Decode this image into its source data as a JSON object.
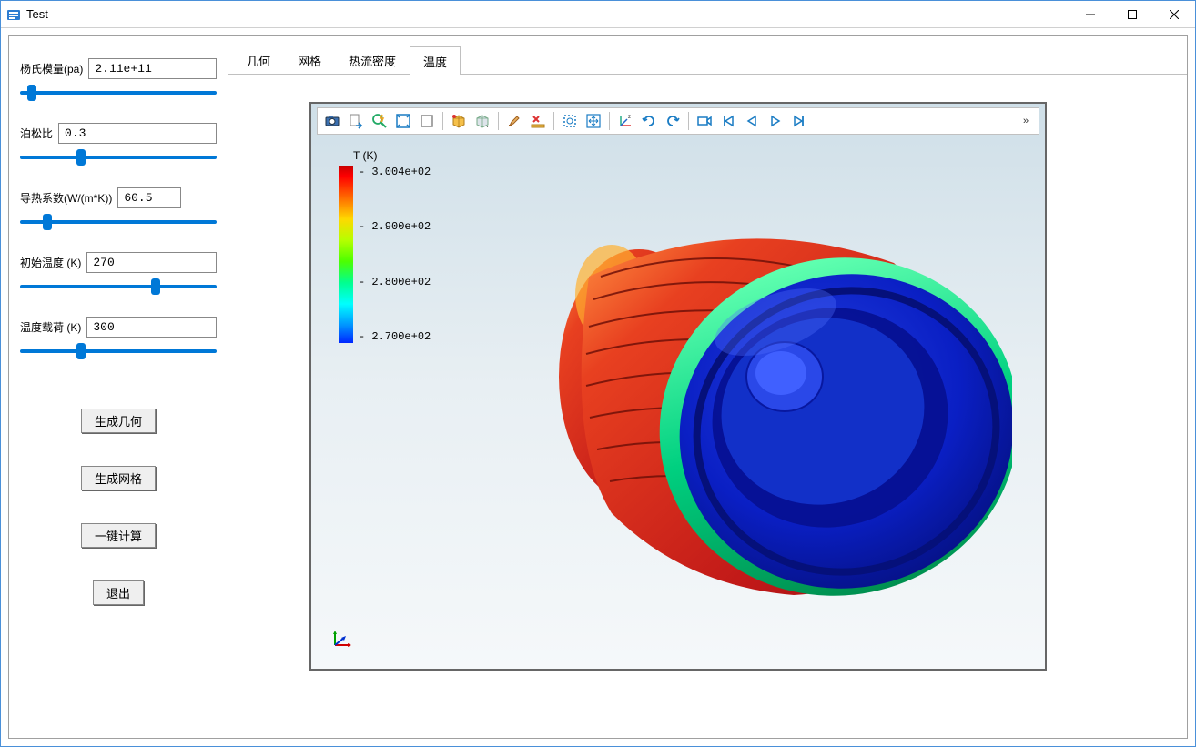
{
  "window": {
    "title": "Test"
  },
  "params": {
    "youngs_modulus": {
      "label": "杨氏模量(pa)",
      "value": "2.11e+11",
      "slider": 4
    },
    "poisson_ratio": {
      "label": "泊松比",
      "value": "0.3",
      "slider": 30
    },
    "thermal_cond": {
      "label": "导热系数(W/(m*K))",
      "value": "60.5",
      "slider": 12
    },
    "initial_temp": {
      "label": "初始温度 (K)",
      "value": "270",
      "slider": 70
    },
    "temp_load": {
      "label": "温度载荷 (K)",
      "value": "300",
      "slider": 30
    }
  },
  "actions": {
    "gen_geometry": "生成几何",
    "gen_mesh": "生成网格",
    "one_click_calc": "一键计算",
    "exit": "退出"
  },
  "tabs": {
    "items": [
      "几何",
      "网格",
      "热流密度",
      "温度"
    ],
    "active": 3
  },
  "legend": {
    "title": "T (K)",
    "ticks": [
      "3.004e+02",
      "2.900e+02",
      "2.800e+02",
      "2.700e+02"
    ]
  },
  "toolbar": {
    "icons": [
      "camera-icon",
      "export-icon",
      "lightning-zoom-icon",
      "fit-box-icon",
      "box-icon",
      "cube-color-icon",
      "cube-menu-icon",
      "brush-icon",
      "x-ruler-icon",
      "select-area-icon",
      "pan-icon",
      "axes-icon",
      "rotate-cw-icon",
      "rotate-ccw-icon",
      "video-icon",
      "skip-back-icon",
      "step-back-icon",
      "play-icon",
      "step-forward-icon"
    ],
    "groups": [
      5,
      2,
      2,
      2,
      3,
      5
    ],
    "more": "»"
  },
  "colors": {
    "accent": "#0078d7",
    "model_hot": "#d62020",
    "model_cold": "#0a1fc4",
    "model_mid": "#00c060"
  }
}
